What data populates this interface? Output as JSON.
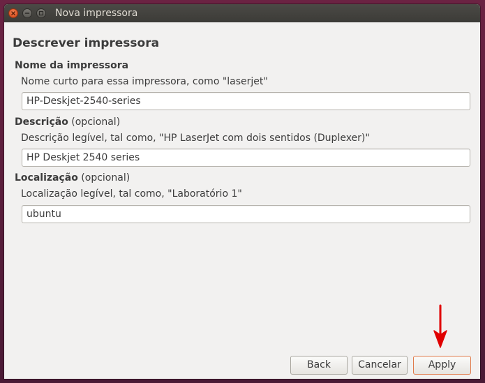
{
  "window": {
    "title": "Nova impressora"
  },
  "page": {
    "heading": "Descrever impressora"
  },
  "name_section": {
    "label": "Nome da impressora",
    "hint": "Nome curto para essa impressora, como \"laserjet\"",
    "value": "HP-Deskjet-2540-series"
  },
  "description_section": {
    "label": "Descrição",
    "optional": "(opcional)",
    "hint": "Descrição legível, tal como, \"HP LaserJet com dois sentidos (Duplexer)\"",
    "value": "HP Deskjet 2540 series"
  },
  "location_section": {
    "label": "Localização",
    "optional": "(opcional)",
    "hint": "Localização legível, tal como, \"Laboratório 1\"",
    "value": "ubuntu"
  },
  "buttons": {
    "back": "Back",
    "cancel": "Cancelar",
    "apply": "Apply"
  },
  "colors": {
    "annotation_arrow": "#e00000",
    "close_button": "#e0592a",
    "apply_border": "#e07a4a"
  },
  "icons": {
    "close": "close-icon",
    "minimize": "minimize-icon",
    "maximize": "maximize-icon",
    "annotation": "arrow-down-icon"
  }
}
